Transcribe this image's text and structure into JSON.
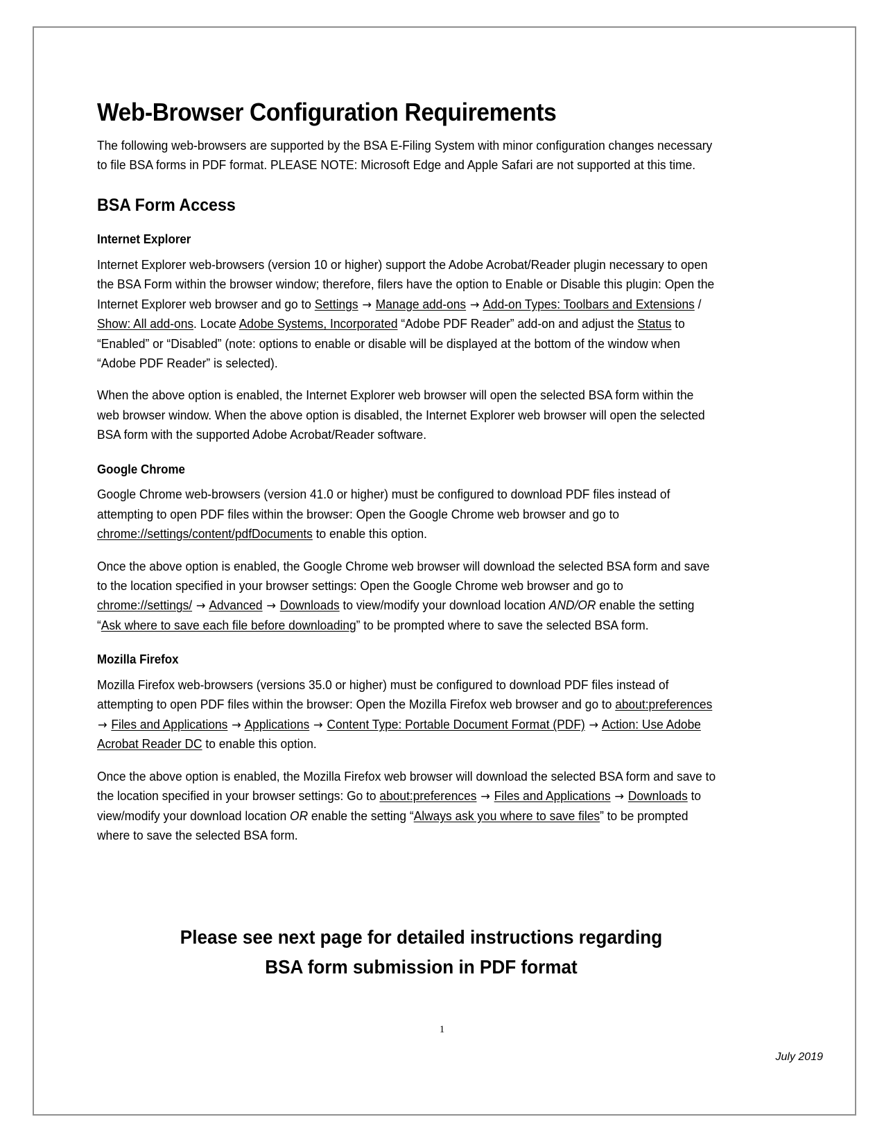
{
  "document": {
    "title": "Web-Browser Configuration Requirements",
    "intro": {
      "line": "The following web-browsers are supported by the BSA E-Filing System with minor configuration changes necessary to file BSA forms in PDF format. PLEASE NOTE: Microsoft Edge and Apple Safari are not supported at this time."
    },
    "section_heading": "BSA Form Access",
    "browsers": [
      {
        "heading": "Internet Explorer",
        "paragraph1": {
          "seg1": "Internet Explorer web-browsers (version 10 or higher) support the Adobe Acrobat/Reader plugin necessary to open the BSA Form within the browser window; therefore, filers have the option to Enable or Disable this plugin: Open the Internet Explorer web browser and go to ",
          "link1": "Settings",
          "arrow1": "→",
          "link2": "Manage add-ons",
          "arrow2": "→",
          "link3": "Add-on Types: Toolbars and Extensions",
          "sep1": " / ",
          "link4": "Show: All add-ons",
          "seg2": ". Locate ",
          "link5": "Adobe Systems, Incorporated",
          "seg3": " “Adobe PDF Reader” add-on and adjust the ",
          "link6": "Status",
          "seg4": " to “Enabled” or “Disabled” (note: options to enable or disable will be displayed at the bottom of the window when “Adobe PDF Reader” is selected)."
        },
        "paragraph2": "When the above option is enabled, the Internet Explorer web browser will open the selected BSA form within the web browser window. When the above option is disabled, the Internet Explorer web browser will open the selected BSA form with the supported Adobe Acrobat/Reader software."
      },
      {
        "heading": "Google Chrome",
        "paragraph1": {
          "seg1": "Google Chrome web-browsers (version 41.0 or higher) must be configured to download PDF files instead of attempting to open PDF files within the browser:  Open the Google Chrome web browser and go to ",
          "link1": "chrome://settings/content/pdfDocuments",
          "seg2": " to enable this option."
        },
        "paragraph2": {
          "seg1": "Once the above option is enabled, the Google Chrome web browser will download the selected BSA form and save to the location specified in your browser settings:  Open the Google Chrome web browser and go to ",
          "link1": "chrome://settings/",
          "arrow1": "→",
          "link2": "Advanced",
          "arrow2": "→",
          "link3": "Downloads",
          "seg2": " to view/modify your download location ",
          "italic1": "AND/OR",
          "seg3": " enable the setting “",
          "link4": "Ask where to save each file before downloading",
          "seg4": "” to be prompted where to save the selected BSA form."
        }
      },
      {
        "heading": "Mozilla Firefox",
        "paragraph1": {
          "seg1": "Mozilla Firefox web-browsers (versions 35.0 or higher) must be configured to download PDF files instead of attempting to open PDF files within the browser: Open the Mozilla Firefox web browser and go to ",
          "link1": "about:preferences",
          "arrow1": "→",
          "link2": "Files and Applications",
          "arrow2": "→",
          "link3": "Applications",
          "arrow3": "→",
          "link4": "Content Type: Portable Document Format (PDF)",
          "arrow4": "→",
          "link5": "Action: Use Adobe Acrobat Reader DC",
          "seg2": " to enable this option."
        },
        "paragraph2": {
          "seg1": "Once the above option is enabled, the Mozilla Firefox web browser will download the selected BSA form and save to the location specified in your browser settings:  Go to ",
          "link1": "about:preferences",
          "arrow1": "→",
          "link2": "Files and Applications",
          "arrow2": "→",
          "link3": "Downloads",
          "seg2": " to view/modify your download location ",
          "italic1": "OR",
          "seg3": " enable the setting “",
          "link4": "Always ask you where to save files",
          "seg4": "” to be prompted where to save the selected BSA form."
        }
      }
    ],
    "closing": {
      "line1": "Please see next page for detailed instructions regarding",
      "line2": "BSA form submission in PDF format"
    },
    "page_number": "1",
    "footer_date": "July 2019"
  }
}
